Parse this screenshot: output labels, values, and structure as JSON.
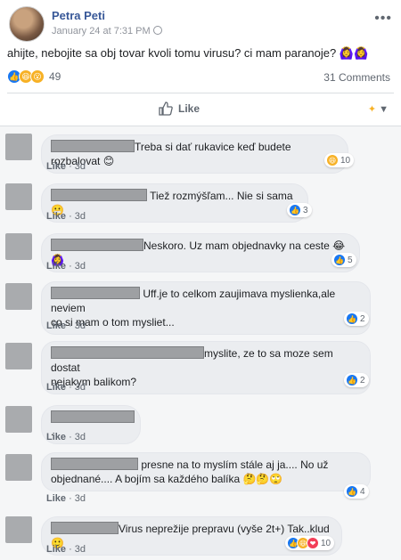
{
  "post": {
    "author": "Petra Peti",
    "date": "January 24 at 7:31 PM",
    "text": "ahijte, nebojite sa obj tovar kvoli tomu virusu? ci mam paranoje? 🙆‍♀️🙆‍♀️",
    "reaction_count": "49",
    "comments_count": "31 Comments",
    "like_label": "Like",
    "reaction_icons": [
      "like-icon",
      "haha-icon",
      "wow-icon"
    ]
  },
  "comments": [
    {
      "text": "Treba si dať rukavice keď budete rozbalovat 😊",
      "line2": "",
      "reactions": [
        "haha-icon"
      ],
      "count": "10",
      "like": "Like",
      "time": "3d"
    },
    {
      "text": "Tiež rozmýšľam... Nie si sama 😬",
      "line2": "",
      "reactions": [
        "like-icon"
      ],
      "count": "3",
      "like": "Like",
      "time": "3d"
    },
    {
      "text": "Neskoro. Uz mam objednavky na ceste 😂🙆‍♀️",
      "line2": "",
      "reactions": [
        "like-icon"
      ],
      "count": "5",
      "like": "Like",
      "time": "3d"
    },
    {
      "text": "Uff.je to celkom zaujimava myslienka,ale neviem",
      "line2": "co si mam o tom mysliet...",
      "reactions": [
        "like-icon"
      ],
      "count": "2",
      "like": "Like",
      "time": "3d"
    },
    {
      "text": "myslite, ze to sa moze sem dostat",
      "line2": "nejakym balikom?",
      "reactions": [
        "like-icon"
      ],
      "count": "2",
      "like": "Like",
      "time": "3d"
    },
    {
      "text": ".",
      "line2": "",
      "reactions": [],
      "count": "",
      "like": "Like",
      "time": "3d"
    },
    {
      "text": "presne na to myslím stále aj ja.... No už",
      "line2": "objednané.... A bojím sa každého balíka 🤔🤔🙄",
      "reactions": [
        "like-icon"
      ],
      "count": "4",
      "like": "Like",
      "time": "3d"
    },
    {
      "text": "Virus neprežije prepravu (vyše 2t+) Tak..klud 🙂",
      "line2": "",
      "reactions": [
        "like-icon",
        "haha-icon",
        "love-icon"
      ],
      "count": "10",
      "like": "Like",
      "time": "3d"
    }
  ],
  "colors": {
    "link": "#385898",
    "like": "#1877f2",
    "haha": "#f7b125",
    "love": "#f33e58"
  }
}
